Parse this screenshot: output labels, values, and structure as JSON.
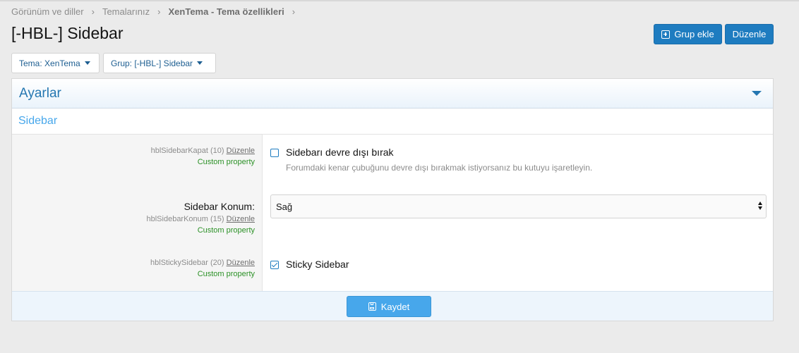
{
  "breadcrumb": {
    "items": [
      "Görünüm ve diller",
      "Temalarınız",
      "XenTema - Tema özellikleri"
    ],
    "separator": "›"
  },
  "page": {
    "title": "[-HBL-] Sidebar"
  },
  "actions": {
    "add_group": "Grup ekle",
    "edit": "Düzenle"
  },
  "filters": {
    "theme": "Tema: XenTema",
    "group": "Grup: [-HBL-] Sidebar"
  },
  "block": {
    "header": "Ayarlar",
    "section": "Sidebar",
    "rows": [
      {
        "meta": "hblSidebarKapat (10)",
        "edit_link": "Düzenle",
        "custom": "Custom property",
        "option_label": "Sidebarı devre dışı bırak",
        "option_hint": "Forumdaki kenar çubuğunu devre dışı bırakmak istiyorsanız bu kutuyu işaretleyin.",
        "checked": false
      },
      {
        "label": "Sidebar Konum:",
        "meta": "hblSidebarKonum (15)",
        "edit_link": "Düzenle",
        "custom": "Custom property",
        "select_value": "Sağ"
      },
      {
        "meta": "hblStickySidebar (20)",
        "edit_link": "Düzenle",
        "custom": "Custom property",
        "option_label": "Sticky Sidebar",
        "checked": true
      }
    ],
    "save_label": "Kaydet"
  },
  "colors": {
    "accent": "#1e7cc0",
    "save": "#47a7eb",
    "custom_property": "#2c9127"
  }
}
